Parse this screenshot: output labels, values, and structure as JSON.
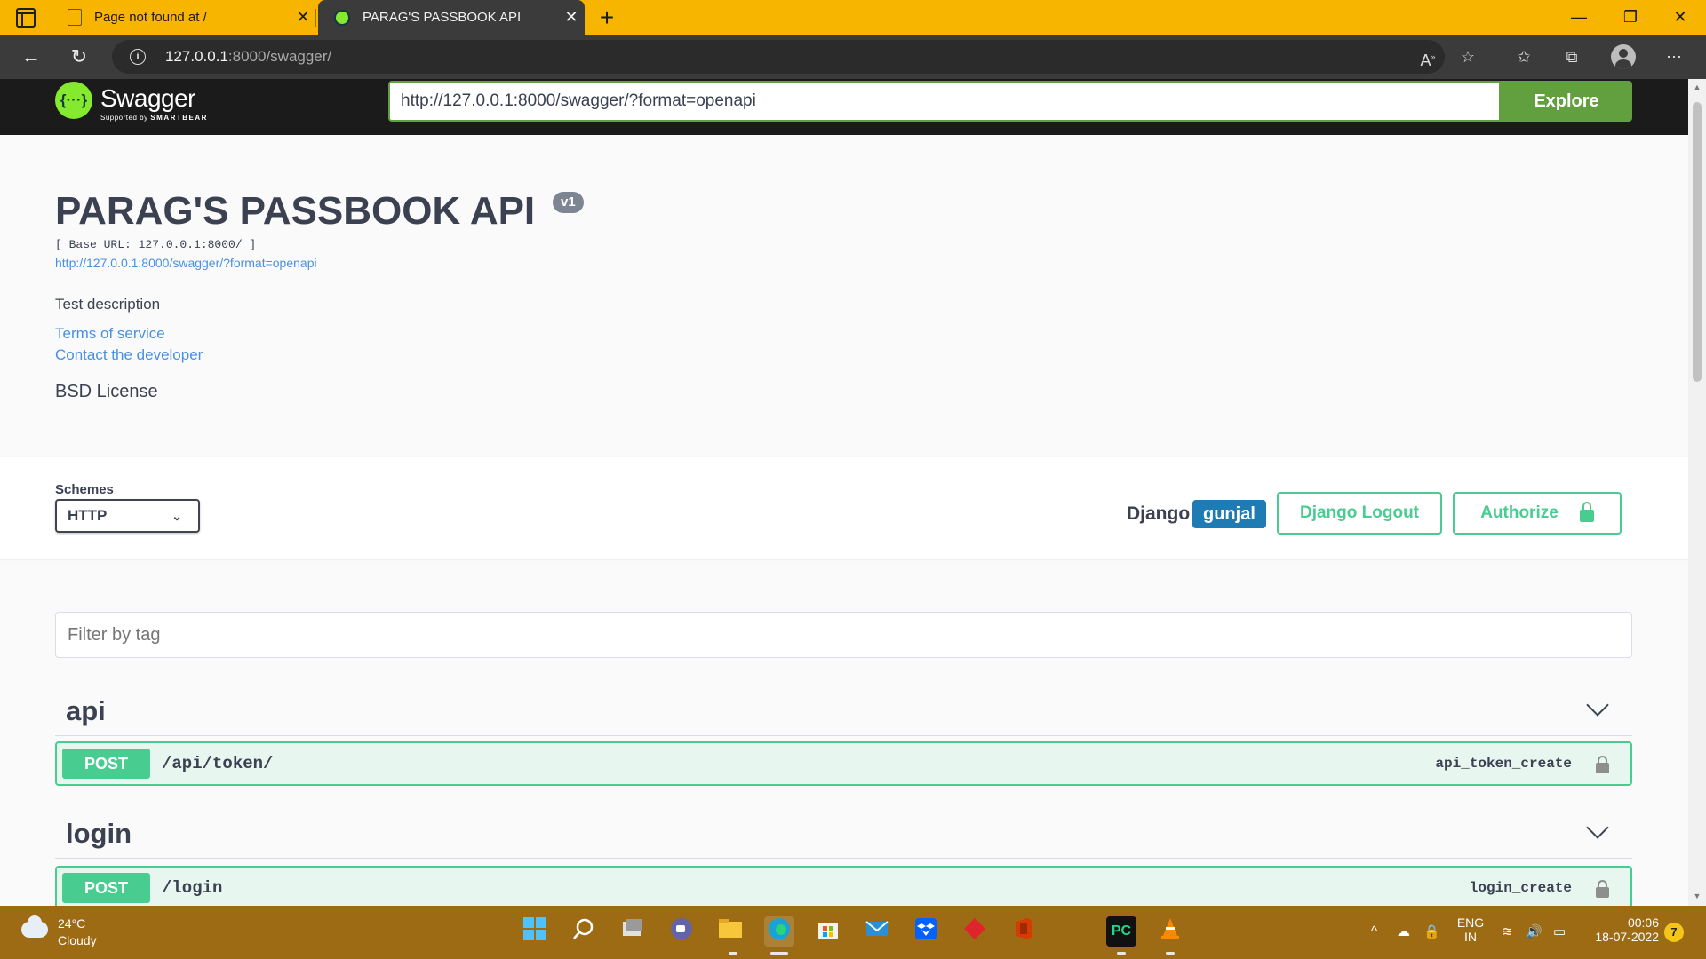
{
  "browser": {
    "tabs": [
      {
        "title": "Page not found at /",
        "active": false
      },
      {
        "title": "PARAG'S PASSBOOK API",
        "active": true
      }
    ],
    "new_tab": "+",
    "address": {
      "host": "127.0.0.1",
      "rest": ":8000/swagger/"
    },
    "window_controls": {
      "minimize": "—",
      "maximize": "❐",
      "close": "✕"
    },
    "colors": {
      "tabstrip": "#f7b500",
      "chrome": "#3b3b3b"
    }
  },
  "swagger": {
    "logo_word": "Swagger",
    "logo_mark": "{···}",
    "logo_sub_prefix": "Supported by",
    "logo_sub_brand": "SMARTBEAR",
    "url_value": "http://127.0.0.1:8000/swagger/?format=openapi",
    "explore_label": "Explore"
  },
  "info": {
    "title": "PARAG'S PASSBOOK API",
    "version": "v1",
    "base_url": "[ Base URL: 127.0.0.1:8000/ ]",
    "spec_link": "http://127.0.0.1:8000/swagger/?format=openapi",
    "description": "Test description",
    "terms": "Terms of service",
    "contact": "Contact the developer",
    "license": "BSD License"
  },
  "schemes": {
    "label": "Schemes",
    "selected": "HTTP",
    "django_label": "Django",
    "user": "gunjal",
    "logout_label": "Django Logout",
    "authorize_label": "Authorize"
  },
  "filter": {
    "placeholder": "Filter by tag"
  },
  "sections": [
    {
      "tag": "api",
      "op": {
        "method": "POST",
        "path": "/api/token/",
        "operation_id": "api_token_create"
      }
    },
    {
      "tag": "login",
      "op": {
        "method": "POST",
        "path": "/login",
        "operation_id": "login_create"
      }
    }
  ],
  "taskbar": {
    "weather": {
      "temp": "24°C",
      "desc": "Cloudy"
    },
    "lang": {
      "line1": "ENG",
      "line2": "IN"
    },
    "clock": {
      "time": "00:06",
      "date": "18-07-2022"
    },
    "notifications": "7",
    "pycharm_label": "PC"
  }
}
